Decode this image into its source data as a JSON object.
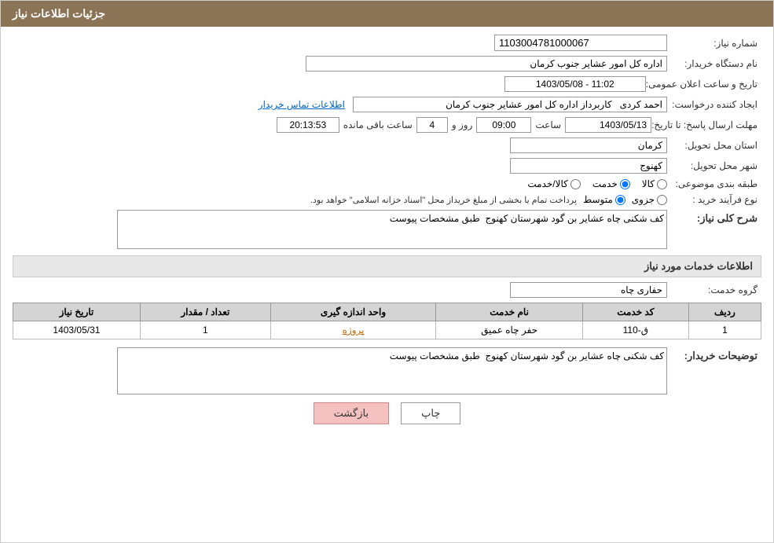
{
  "header": {
    "title": "جزئیات اطلاعات نیاز"
  },
  "fields": {
    "need_number_label": "شماره نیاز:",
    "need_number_value": "1103004781000067",
    "buyer_org_label": "نام دستگاه خریدار:",
    "buyer_org_value": "اداره کل امور عشایر جنوب کرمان",
    "announce_date_label": "تاریخ و ساعت اعلان عمومی:",
    "announce_date_value": "1403/05/08 - 11:02",
    "creator_label": "ایجاد کننده درخواست:",
    "creator_value": "احمد کردی   کاربرداز اداره کل امور عشایر جنوب کرمان",
    "contact_link": "اطلاعات تماس خریدار",
    "deadline_label": "مهلت ارسال پاسخ: تا تاریخ:",
    "deadline_date": "1403/05/13",
    "deadline_time_label": "ساعت",
    "deadline_time": "09:00",
    "deadline_days_label": "روز و",
    "deadline_days": "4",
    "deadline_remaining_label": "ساعت باقی مانده",
    "deadline_remaining": "20:13:53",
    "province_label": "استان محل تحویل:",
    "province_value": "کرمان",
    "city_label": "شهر محل تحویل:",
    "city_value": "کهنوج",
    "category_label": "طبقه بندی موضوعی:",
    "category_kala": "کالا",
    "category_khedmat": "خدمت",
    "category_kala_khedmat": "کالا/خدمت",
    "process_label": "نوع فرآیند خرید :",
    "process_jozvi": "جزوی",
    "process_motevaset": "متوسط",
    "process_desc": "پرداخت تمام یا بخشی از مبلغ خریداز محل \"اسناد خزانه اسلامی\" خواهد بود.",
    "need_desc_label": "شرح کلی نیاز:",
    "need_desc_value": "کف شکنی چاه عشایر بن گود شهرستان کهنوج  طبق مشخصات پیوست",
    "services_info_title": "اطلاعات خدمات مورد نیاز",
    "service_group_label": "گروه خدمت:",
    "service_group_value": "حفاری چاه"
  },
  "table": {
    "headers": [
      "ردیف",
      "کد خدمت",
      "نام خدمت",
      "واحد اندازه گیری",
      "تعداد / مقدار",
      "تاریخ نیاز"
    ],
    "rows": [
      {
        "row_num": "1",
        "service_code": "ق-110",
        "service_name": "حفر چاه عمیق",
        "unit": "پروژه",
        "quantity": "1",
        "date": "1403/05/31"
      }
    ]
  },
  "buyer_desc_label": "توضیحات خریدار:",
  "buyer_desc_value": "کف شکنی چاه عشایر بن گود شهرستان کهنوج  طبق مشخصات پیوست",
  "buttons": {
    "print": "چاپ",
    "back": "بازگشت"
  }
}
